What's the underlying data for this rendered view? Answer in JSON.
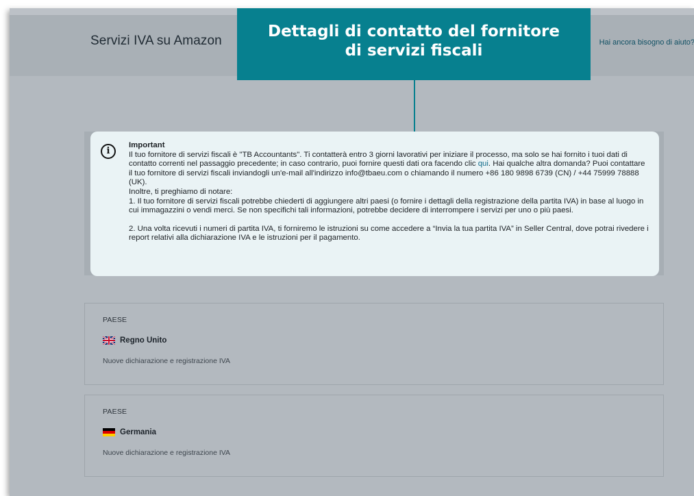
{
  "header": {
    "title": "Servizi IVA su Amazon",
    "help_link": "Hai ancora bisogno di aiuto?"
  },
  "callout": {
    "line1": "Dettagli di contatto del fornitore",
    "line2": "di servizi fiscali"
  },
  "important": {
    "icon": "info-icon",
    "title": "Important",
    "p1_before_link": "Il tuo fornitore di servizi fiscali è \"TB Accountants\". Ti contatterà entro 3 giorni lavorativi per iniziare il processo, ma solo se hai fornito i tuoi dati di contatto correnti nel passaggio precedente; in caso contrario, puoi fornire questi dati ora facendo clic ",
    "p1_link": "qui",
    "p1_after_link": ". Hai qualche altra domanda? Puoi contattare il tuo fornitore di servizi fiscali inviandogli un'e-mail all'indirizzo info@tbaeu.com o chiamando il numero +86 180 9898 6739 (CN) / +44 75999 78888 (UK).",
    "p2": "Inoltre, ti preghiamo di notare:",
    "p3": "1. Il tuo fornitore di servizi fiscali potrebbe chiederti di aggiungere altri paesi (o fornire i dettagli della registrazione della partita IVA) in base al luogo in cui immagazzini o vendi merci. Se non specifichi tali informazioni, potrebbe decidere di interrompere i servizi per uno o più paesi.",
    "p4": "2. Una volta ricevuti i numeri di partita IVA, ti forniremo le istruzioni su come accedere a “Invia la tua partita IVA” in Seller Central, dove potrai rivedere i report relativi alla dichiarazione IVA e le istruzioni per il pagamento."
  },
  "countries": [
    {
      "label": "PAESE",
      "name": "Regno Unito",
      "flag": "uk-flag-icon",
      "description": "Nuove dichiarazione e registrazione IVA"
    },
    {
      "label": "PAESE",
      "name": "Germania",
      "flag": "germany-flag-icon",
      "description": "Nuove dichiarazione e registrazione IVA"
    }
  ]
}
